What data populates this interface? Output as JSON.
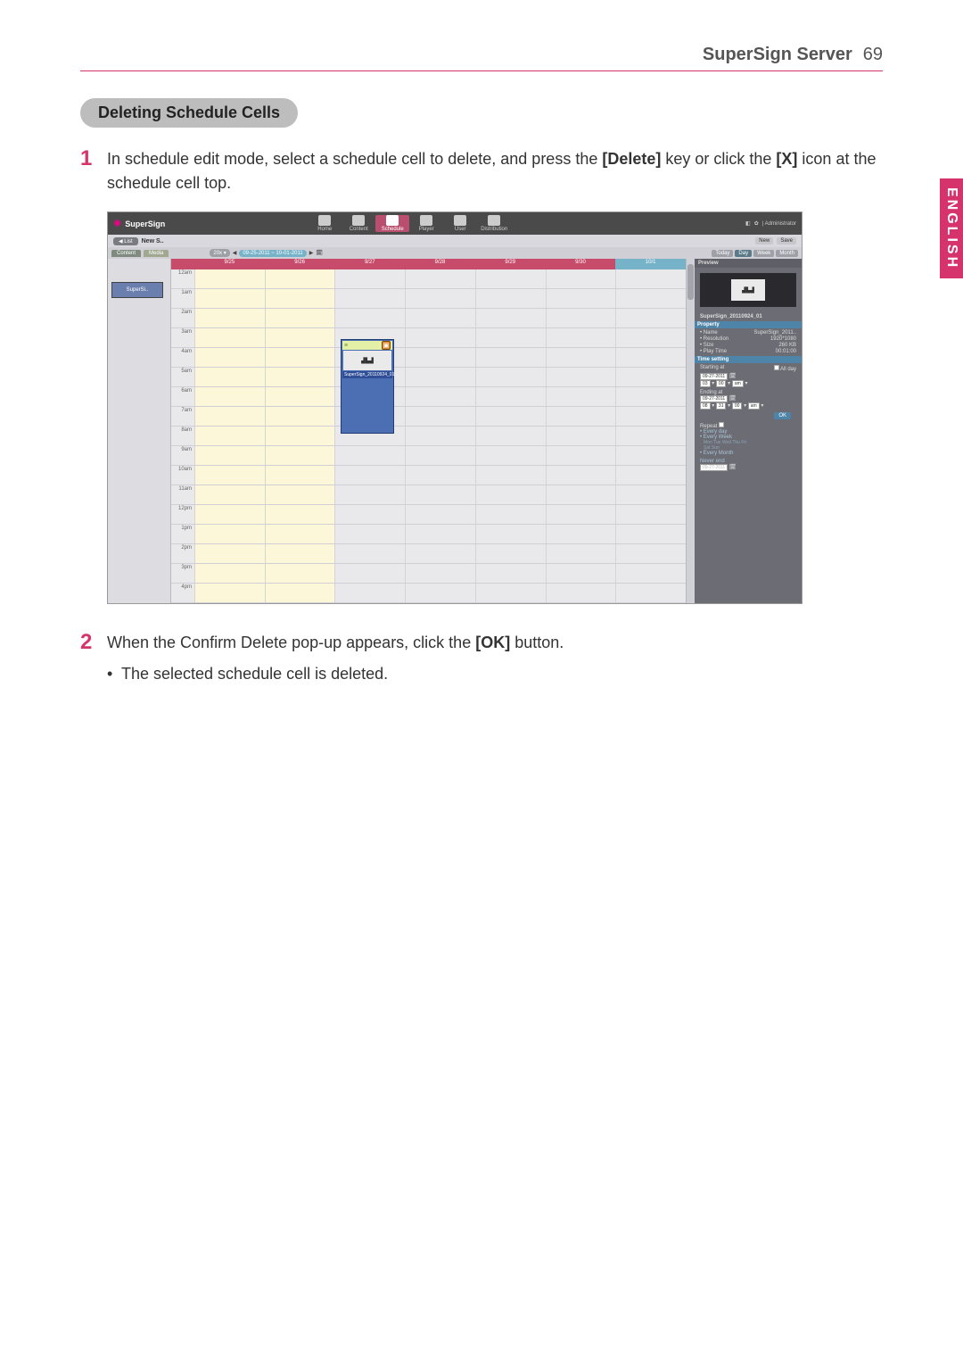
{
  "header": {
    "title": "SuperSign Server",
    "page": "69"
  },
  "lang_tab": "ENGLISH",
  "section_title": "Deleting Schedule Cells",
  "steps": {
    "s1": {
      "num": "1",
      "pre": "In schedule edit mode, select a schedule cell to delete, and press the ",
      "key1": "[Delete]",
      "mid": " key or click the ",
      "key2": "[X]",
      "post": " icon at the schedule cell top."
    },
    "s2": {
      "num": "2",
      "pre": "When the Confirm Delete pop-up appears, click the ",
      "key1": "[OK]",
      "post": " button."
    },
    "s2_bullet": "The selected schedule cell is deleted."
  },
  "shot": {
    "logo": "SuperSign",
    "nav": {
      "home": "Home",
      "content": "Content",
      "schedule": "Schedule",
      "player": "Player",
      "user": "User",
      "distribution": "Distribution"
    },
    "top_right": "| Administrator",
    "secbar": {
      "list": "List",
      "title": "New S..",
      "new": "New",
      "save": "Save"
    },
    "thirdbar": {
      "tab_content": "Content",
      "tab_media": "Media",
      "range": "09-25-2011 ~ 10-01-2011",
      "views": {
        "today": "Today",
        "day": "Day",
        "week": "Week",
        "month": "Month"
      }
    },
    "cal_head_dates": [
      "9/25",
      "9/26",
      "9/27",
      "9/28",
      "9/29",
      "9/30",
      "10/1"
    ],
    "hours": [
      "12am",
      "1am",
      "2am",
      "3am",
      "4am",
      "5am",
      "6am",
      "7am",
      "8am",
      "9am",
      "10am",
      "11am",
      "12pm",
      "1pm",
      "2pm",
      "3pm",
      "4pm"
    ],
    "sidebar_item": "SuperSi..",
    "event_title": "SuperSign_20110924_01",
    "props": {
      "head_preview": "Preview",
      "item_name": "SuperSign_20110924_01",
      "hd_property": "Property",
      "name_k": "• Name",
      "name_v": "SuperSign_2011..",
      "res_k": "• Resolution",
      "res_v": "1920*1080",
      "size_k": "• Size",
      "size_v": "260 KB",
      "pt_k": "• Play Time",
      "pt_v": "00:01:00",
      "hd_time": "Time setting",
      "start_k": "Starting at",
      "allday": "All day",
      "date_start": "09-27-2011",
      "h1": "03",
      "m1": "00",
      "ap1": "am",
      "end_k": "Ending at",
      "date_end": "09-27-2011",
      "h2": "08",
      "m2": "31",
      "s2": "00",
      "ap2": "am",
      "ok": "OK",
      "repeat_k": "Repeat",
      "every_day": "• Every day",
      "every_week": "• Every Week",
      "days_line": "Mon  Tue  Wed  Thu  Fri",
      "days_line2": "Sat  Sun",
      "every_month": "• Every Month",
      "never_end": "Never end",
      "endat_date": "09-27-2011"
    }
  }
}
